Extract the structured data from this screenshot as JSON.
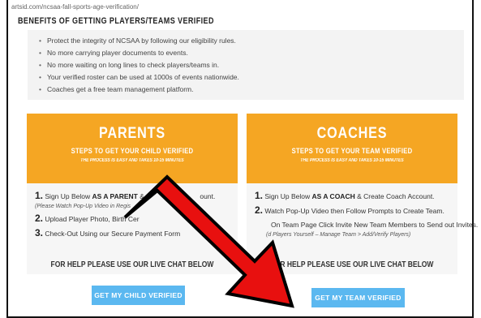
{
  "browser": {
    "url": "artsid.com/ncsaa-fall-sports-age-verification/"
  },
  "benefits": {
    "title": "BENEFITS OF GETTING PLAYERS/TEAMS VERIFIED",
    "items": [
      "Protect the integrity of NCSAA by following our eligibility rules.",
      "No more carrying player documents to events.",
      "No more waiting on long lines to check players/teams in.",
      "Your verified roster can be used at 1000s of events nationwide.",
      "Coaches get a free team management platform."
    ]
  },
  "parents": {
    "title": "PARENTS",
    "subtitle": "STEPS TO GET YOUR CHILD VERIFIED",
    "note": "THE PROCESS IS EASY AND TAKES 10-15 MINUTES",
    "step1_num": "1.",
    "step1_pre": "Sign Up Below ",
    "step1_bold": "AS A PARENT",
    "step1_post": " & C",
    "step1_tail": "ount.",
    "step1_note": "(Please Watch Pop-Up Video in Regis",
    "step2_num": "2.",
    "step2_text": "Upload Player Photo, Birth Cer",
    "step3_num": "3.",
    "step3_text": "Check-Out Using our Secure Payment Form",
    "help": "FOR HELP PLEASE USE OUR LIVE CHAT BELOW",
    "button": "GET MY CHILD VERIFIED"
  },
  "coaches": {
    "title": "COACHES",
    "subtitle": "STEPS TO GET YOUR TEAM VERIFIED",
    "note": "THE PROCESS IS EASY AND TAKES 10-15 MINUTES",
    "step1_num": "1.",
    "step1_pre": "Sign Up Below ",
    "step1_bold": "AS A COACH",
    "step1_post": " & Create Coach Account.",
    "step2_num": "2.",
    "step2_text": "Watch Pop-Up Video then Follow Prompts to Create Team.",
    "step3_text": "On Team Page Click Invite New Team Members to Send out Invites.",
    "step3_note": "(d Players Yourself – Manage Team > Add/Verify Players)",
    "help": "FOR HELP PLEASE USE OUR LIVE CHAT BELOW",
    "button": "GET MY TEAM VERIFIED"
  },
  "colors": {
    "accent": "#f5a623",
    "button": "#5bb8f0",
    "arrow": "#e8100f"
  }
}
